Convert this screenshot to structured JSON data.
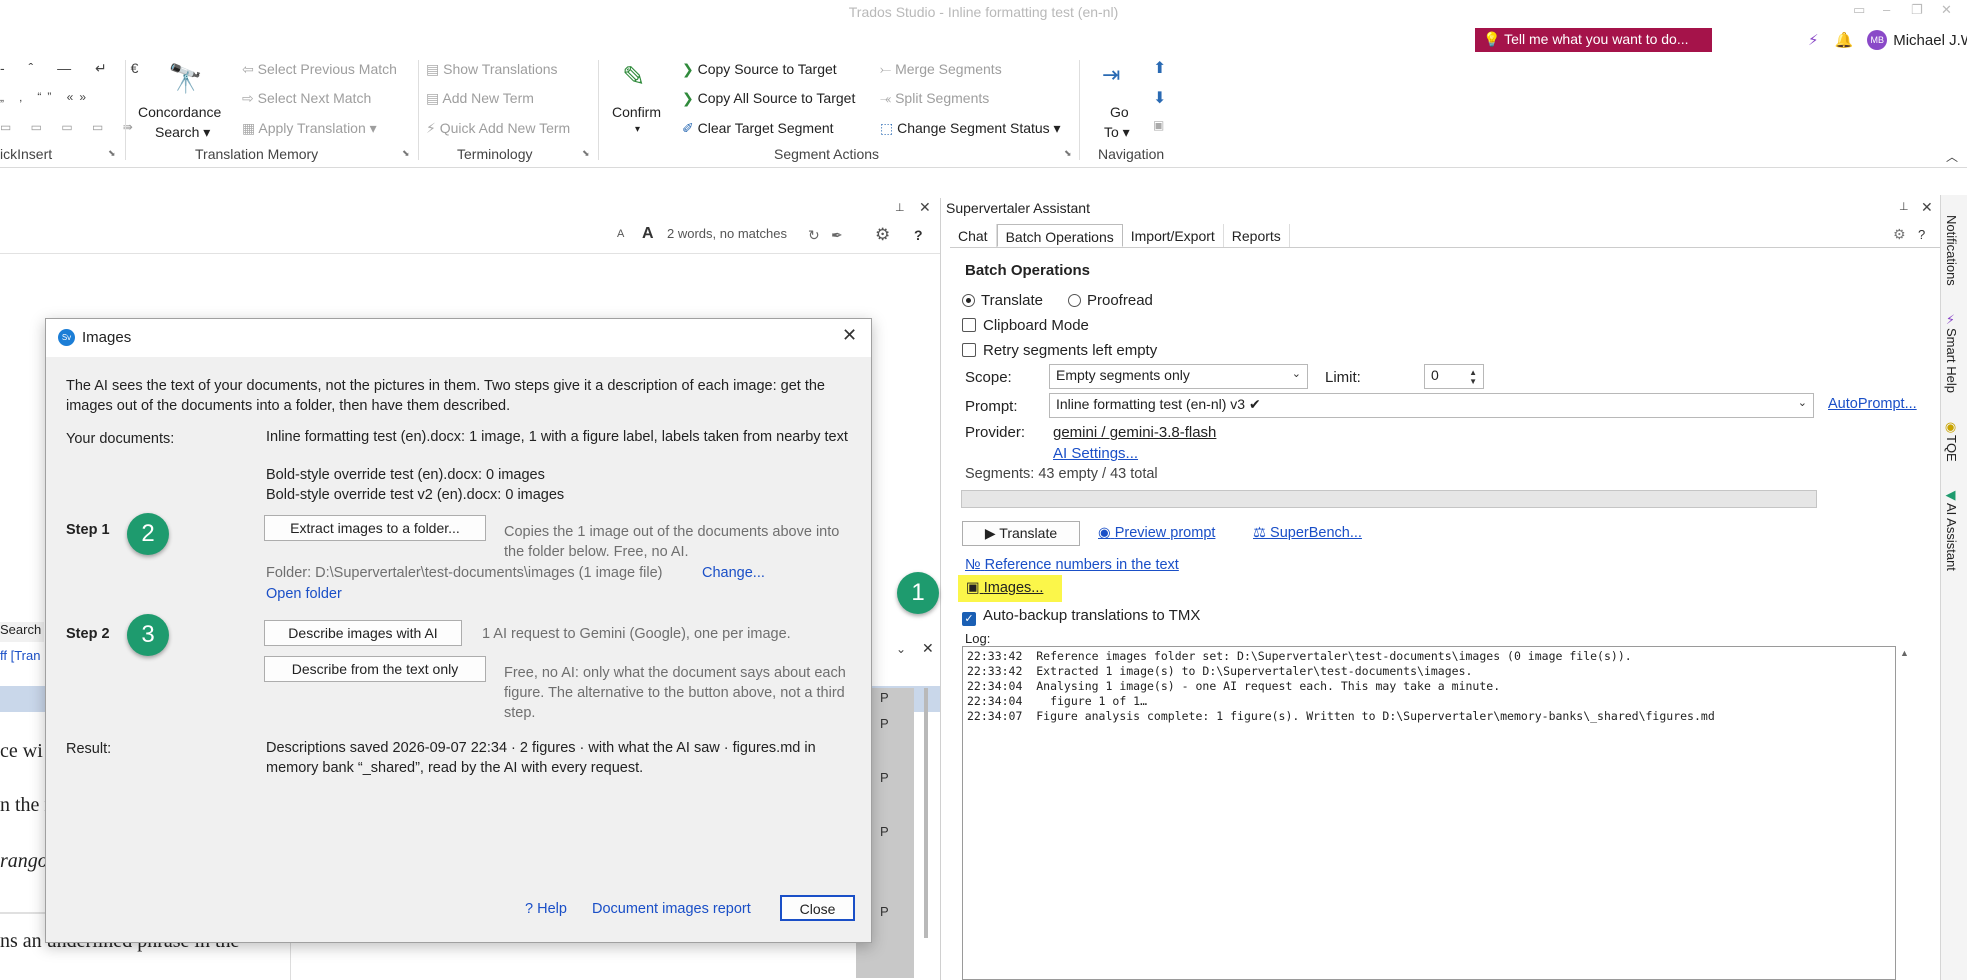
{
  "window": {
    "title": "Trados Studio - Inline formatting test (en-nl)",
    "tell_me": "Tell me what you want to do...",
    "user_initials": "MB",
    "user_name": "Michael J.W. Beijer"
  },
  "ribbon": {
    "quickinsert_group": "ickInsert",
    "quickinsert_symbols": [
      "- ˆ — ↵ €",
      "„ ‚ “” «»"
    ],
    "concordance_label": "Concordance",
    "concordance_sub": "Search",
    "tm_items": [
      "Select Previous Match",
      "Select Next Match",
      "Apply Translation"
    ],
    "tm_group": "Translation Memory",
    "term_items": [
      "Show Translations",
      "Add New Term",
      "Quick Add New Term"
    ],
    "term_group": "Terminology",
    "confirm_label": "Confirm",
    "segment_items": [
      "Copy Source to Target",
      "Copy All Source to Target",
      "Clear Target Segment"
    ],
    "segment_items_right": [
      "Merge Segments",
      "Split Segments",
      "Change Segment Status"
    ],
    "segment_group": "Segment Actions",
    "goto_label": "Go",
    "goto_sub": "To",
    "navigation_group": "Navigation"
  },
  "editor": {
    "status": "2 words, no matches",
    "font_small": "A",
    "font_large": "A",
    "search_tab": "Search",
    "diff_tab": "ff [Tran",
    "fragments": [
      "ce wi",
      "n the r",
      "rango",
      "ns an underlined phrase in the"
    ],
    "status_letter": "P"
  },
  "assistant": {
    "panel_title": "Supervertaler Assistant",
    "tabs": [
      "Chat",
      "Batch Operations",
      "Import/Export",
      "Reports"
    ],
    "section_title": "Batch Operations",
    "mode_translate": "Translate",
    "mode_proofread": "Proofread",
    "clipboard_mode": "Clipboard Mode",
    "retry_empty": "Retry segments left empty",
    "scope_label": "Scope:",
    "scope_value": "Empty segments only",
    "limit_label": "Limit:",
    "limit_value": "0",
    "prompt_label": "Prompt:",
    "prompt_value": "Inline formatting test (en-nl) v3",
    "autoprompt": "AutoPrompt...",
    "provider_label": "Provider:",
    "provider_value": "gemini / gemini-3.8-flash",
    "ai_settings": "AI Settings...",
    "segments_summary": "Segments: 43 empty / 43 total",
    "translate_button": "Translate",
    "preview_prompt": "Preview prompt",
    "superbench": "SuperBench...",
    "reference_numbers": "Reference numbers in the text",
    "images_link": "Images...",
    "auto_backup": "Auto-backup translations to TMX",
    "log_label": "Log:",
    "log_lines": [
      "22:33:42  Reference images folder set: D:\\Supervertaler\\test-documents\\images (0 image file(s)).",
      "22:33:42  Extracted 1 image(s) to D:\\Supervertaler\\test-documents\\images.",
      "22:34:04  Analysing 1 image(s) - one AI request each. This may take a minute.",
      "22:34:04    figure 1 of 1…",
      "22:34:07  Figure analysis complete: 1 figure(s). Written to D:\\Supervertaler\\memory-banks\\_shared\\figures.md"
    ]
  },
  "sidebar": {
    "tabs": [
      "Notifications",
      "Smart Help",
      "TQE",
      "AI Assistant"
    ]
  },
  "dialog": {
    "title": "Images",
    "app_badge": "Sv",
    "intro": "The AI sees the text of your documents, not the pictures in them. Two steps give it a description of each image: get the images out of the documents into a folder, then have them described.",
    "docs_label": "Your documents:",
    "docs": [
      "Inline formatting test (en).docx: 1 image, 1 with a figure label, labels taken from nearby text",
      "Bold-style override test (en).docx: 0 images",
      "Bold-style override test v2 (en).docx: 0 images"
    ],
    "step1_label": "Step 1",
    "extract_button": "Extract images to a folder...",
    "extract_desc": "Copies the 1 image out of the documents above into the folder below. Free, no AI.",
    "folder_text": "Folder: D:\\Supervertaler\\test-documents\\images  (1 image file)",
    "change_link": "Change...",
    "open_folder": "Open folder",
    "step2_label": "Step 2",
    "describe_ai_button": "Describe images with AI",
    "describe_ai_desc": "1 AI request to Gemini (Google), one per image.",
    "describe_text_button": "Describe from the text only",
    "describe_text_desc": "Free, no AI: only what the document says about each figure. The alternative to the button above, not a third step.",
    "result_label": "Result:",
    "result_text": "Descriptions saved 2026-09-07 22:34 · 2 figures · with what the AI saw · figures.md in memory bank “_shared”, read by the AI with every request.",
    "help_link": "? Help",
    "report_link": "Document images report",
    "close_button": "Close"
  },
  "callouts": [
    "1",
    "2",
    "3"
  ],
  "colors": {
    "accent_link": "#1a4fc7",
    "tell_me_bg": "#a5134a",
    "callout": "#1e9b6e",
    "highlight": "#fbf64a"
  }
}
